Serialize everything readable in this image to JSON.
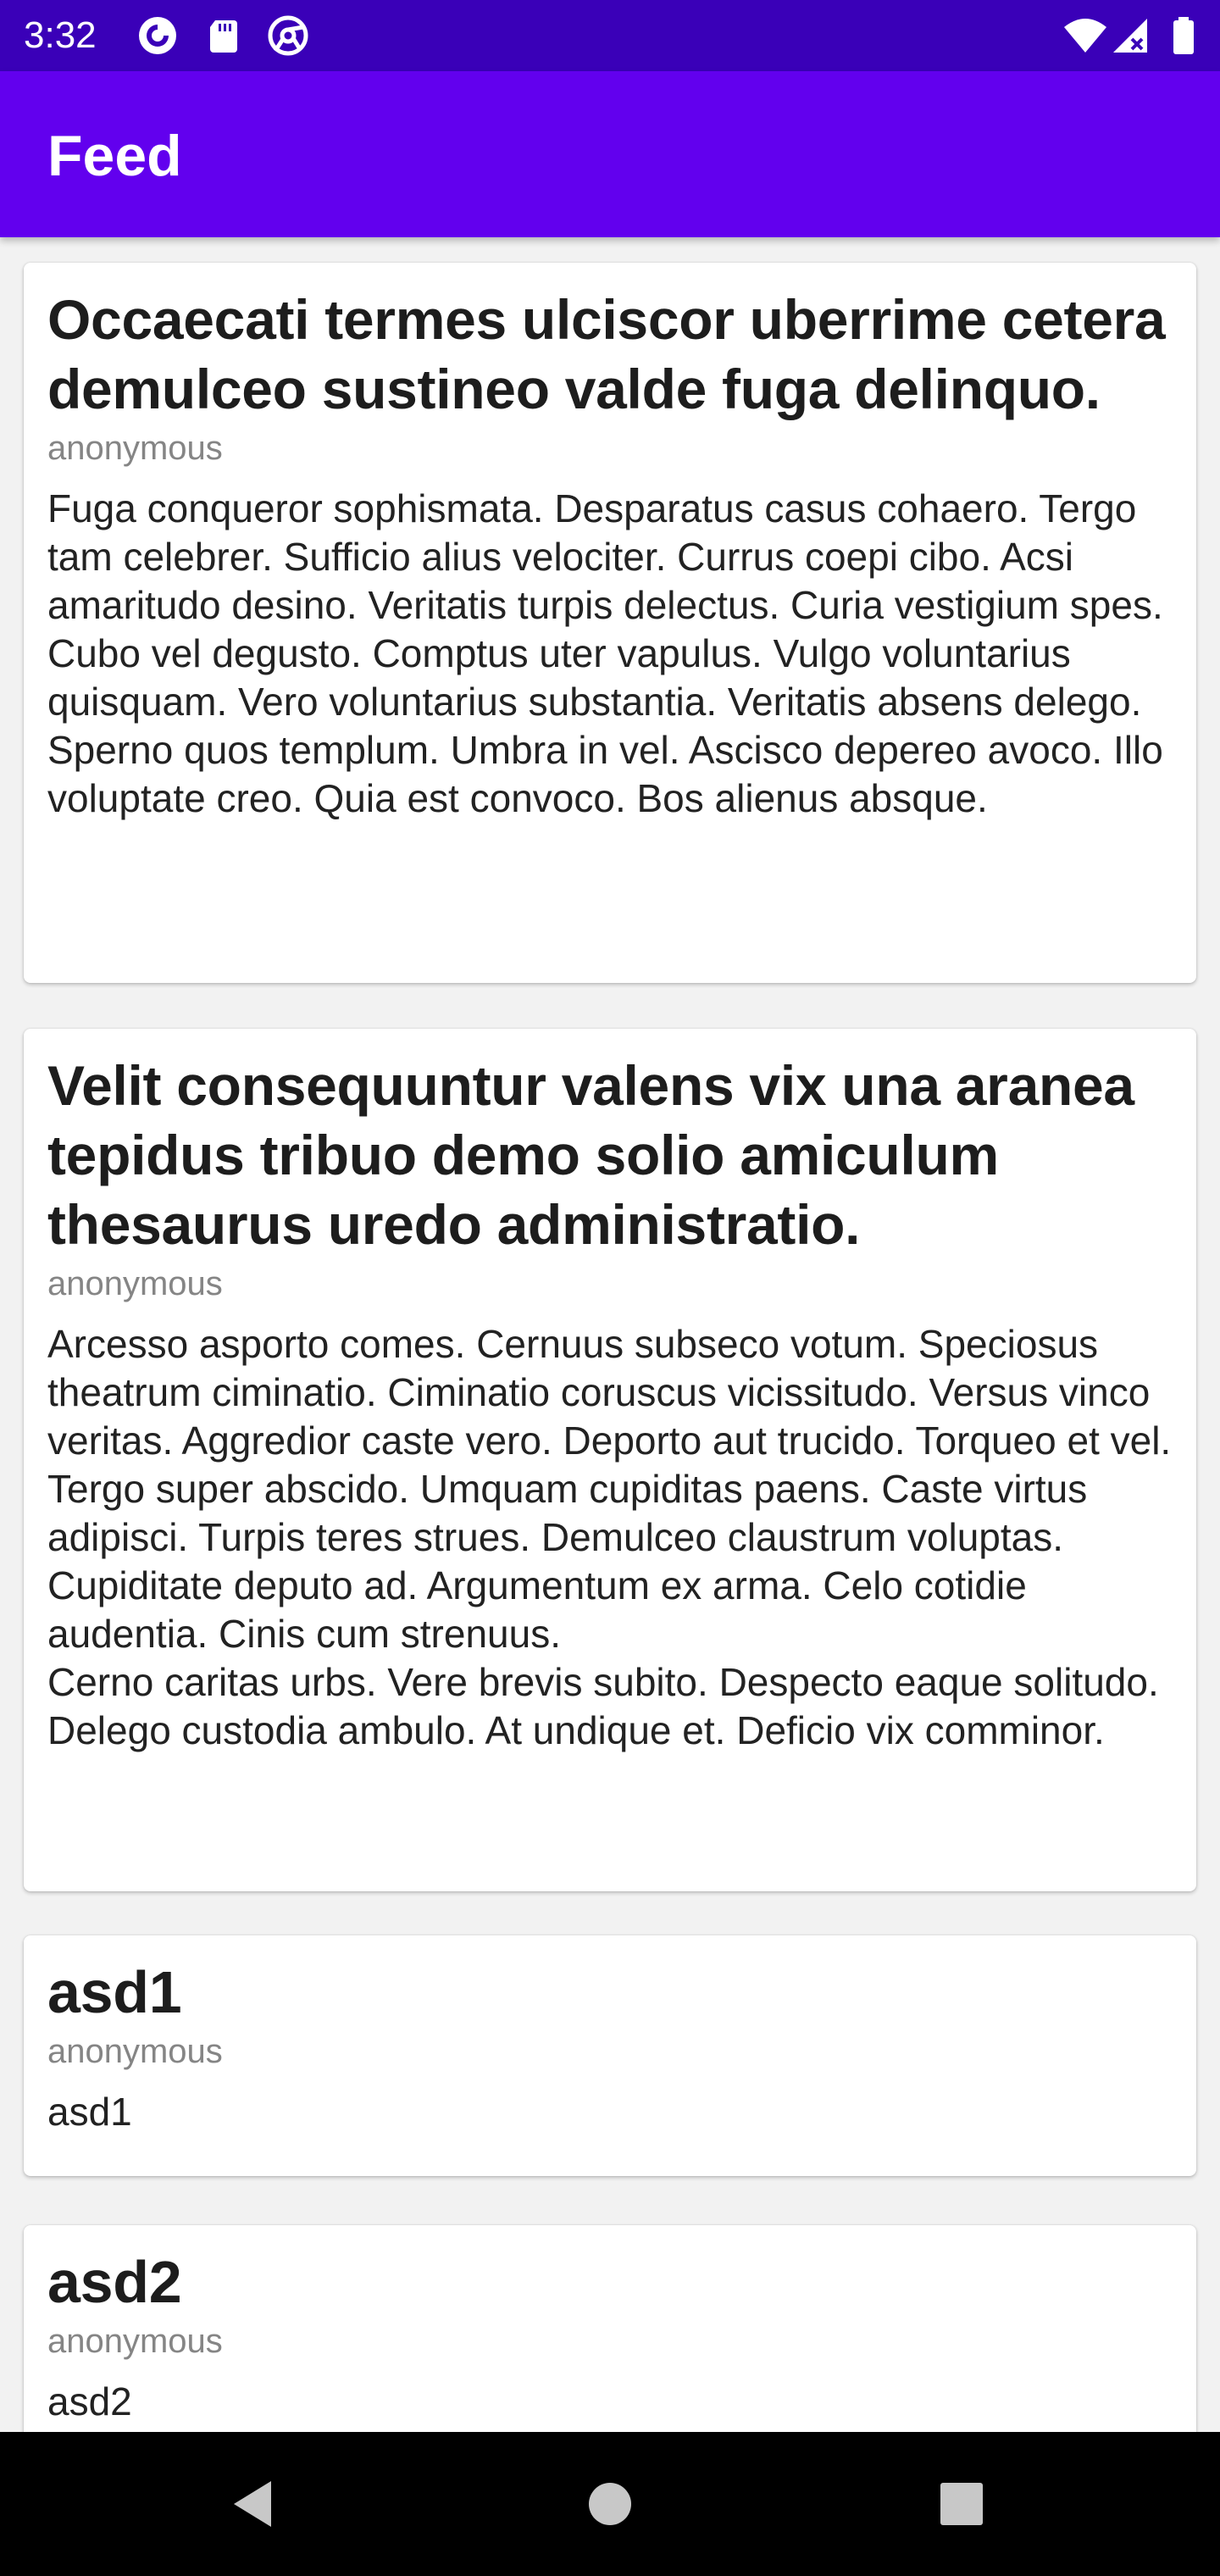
{
  "status_bar": {
    "time": "3:32",
    "icons_left": [
      "pocket-casts-icon",
      "sd-card-icon",
      "chrome-icon"
    ],
    "icons_right": [
      "wifi-icon",
      "no-signal-icon",
      "battery-icon"
    ],
    "background": "#3a00b8"
  },
  "app_bar": {
    "title": "Feed",
    "background": "#6200ee"
  },
  "posts": [
    {
      "title": "Occaecati termes ulciscor uberrime cetera demulceo sustineo valde fuga delinquo.",
      "author": "anonymous",
      "body": "Fuga conqueror sophismata. Desparatus casus cohaero. Tergo tam celebrer. Sufficio alius velociter. Currus coepi cibo. Acsi amaritudo desino. Veritatis turpis delectus. Curia vestigium spes. Cubo vel degusto. Comptus uter vapulus. Vulgo voluntarius quisquam. Vero voluntarius substantia. Veritatis absens delego. Sperno quos templum. Umbra in vel. Ascisco depereo avoco. Illo voluptate creo. Quia est convoco. Bos alienus absque."
    },
    {
      "title": "Velit consequuntur valens vix una aranea tepidus tribuo demo solio amiculum thesaurus uredo administratio.",
      "author": "anonymous",
      "body": "Arcesso asporto comes. Cernuus subseco votum. Speciosus theatrum ciminatio. Ciminatio coruscus vicissitudo. Versus vinco veritas. Aggredior caste vero. Deporto aut trucido. Torqueo et vel. Tergo super abscido. Umquam cupiditas paens. Caste virtus adipisci. Turpis teres strues. Demulceo claustrum voluptas. Cupiditate deputo ad. Argumentum ex arma. Celo cotidie audentia. Cinis cum strenuus.\nCerno caritas urbs. Vere brevis subito. Despecto eaque solitudo. Delego custodia ambulo. At undique et. Deficio vix comminor."
    },
    {
      "title": "asd1",
      "author": "anonymous",
      "body": "asd1"
    },
    {
      "title": "asd2",
      "author": "anonymous",
      "body": "asd2"
    }
  ],
  "nav_bar": {
    "buttons": [
      "back-icon",
      "home-icon",
      "recents-icon"
    ]
  }
}
